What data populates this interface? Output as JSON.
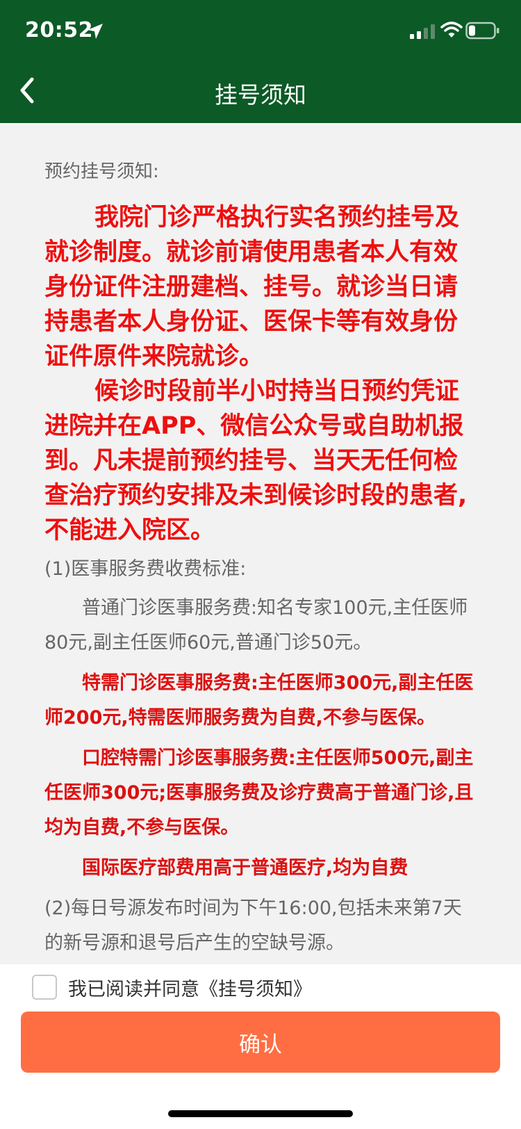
{
  "status_bar": {
    "time": "20:52",
    "icons": [
      "location-arrow-icon",
      "signal-icon",
      "wifi-icon",
      "battery-icon"
    ]
  },
  "nav": {
    "title": "挂号须知",
    "back_icon": "chevron-left-icon"
  },
  "content": {
    "section_title": "预约挂号须知:",
    "alert_paragraphs": [
      "我院门诊严格执行实名预约挂号及就诊制度。就诊前请使用患者本人有效身份证件注册建档、挂号。就诊当日请持患者本人身份证、医保卡等有效身份证件原件来院就诊。",
      "候诊时段前半小时持当日预约凭证进院并在APP、微信公众号或自助机报到。凡未提前预约挂号、当天无任何检查治疗预约安排及未到候诊时段的患者,不能进入院区。"
    ],
    "fee_title": "(1)医事服务费收费标准:",
    "fee_normal": "普通门诊医事服务费:知名专家100元,主任医师80元,副主任医师60元,普通门诊50元。",
    "fee_special": "特需门诊医事服务费:主任医师300元,副主任医师200元,特需医师服务费为自费,不参与医保。",
    "fee_dental": "口腔特需门诊医事服务费:主任医师500元,副主任医师300元;医事服务费及诊疗费高于普通门诊,且均为自费,不参与医保。",
    "fee_international": "国际医疗部费用高于普通医疗,均为自费",
    "release_info": "(2)每日号源发布时间为下午16:00,包括未来第7天的新号源和退号后产生的空缺号源。"
  },
  "footer": {
    "agree_label": "我已阅读并同意《挂号须知》",
    "agree_checked": false,
    "confirm_label": "确认"
  },
  "colors": {
    "header_bg": "#0c5a26",
    "alert_red": "#ee0f0f",
    "confirm_orange": "#ff6e43",
    "content_bg": "#f2f2f2"
  }
}
